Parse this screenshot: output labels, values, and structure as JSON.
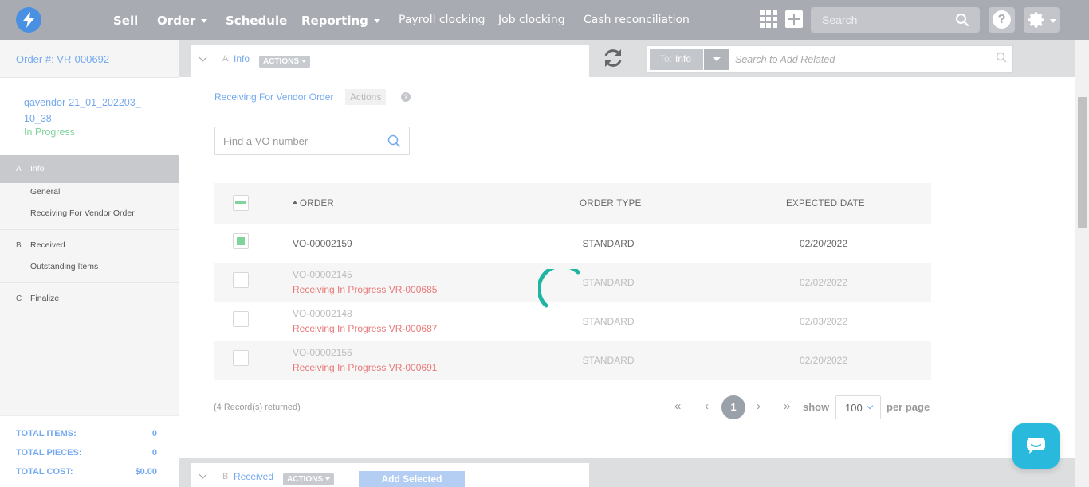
{
  "topnav": {
    "menu": [
      {
        "label": "Sell",
        "caret": false
      },
      {
        "label": "Order",
        "caret": true
      },
      {
        "label": "Schedule",
        "caret": false
      },
      {
        "label": "Reporting",
        "caret": true
      }
    ],
    "links": [
      "Payroll clocking",
      "Job clocking",
      "Cash reconciliation"
    ],
    "search_placeholder": "Search",
    "help_label": "?",
    "icons": {
      "logo": "lightning-bolt-icon",
      "apps": "apps-grid-icon",
      "add": "plus-icon",
      "search": "search-icon",
      "settings": "gear-icon"
    }
  },
  "sidebar": {
    "order_title": "Order #: VR-000692",
    "vendor_name": "qavendor-21_01_202203_10_38",
    "vendor_status": "In Progress",
    "sections": [
      {
        "letter": "A",
        "label": "Info",
        "active": true,
        "items": [
          "General",
          "Receiving For Vendor Order"
        ]
      },
      {
        "letter": "B",
        "label": "Received",
        "active": false,
        "items": [
          "Outstanding Items"
        ]
      },
      {
        "letter": "C",
        "label": "Finalize",
        "active": false,
        "items": []
      }
    ],
    "totals": [
      {
        "label": "TOTAL ITEMS:",
        "value": "0"
      },
      {
        "label": "TOTAL PIECES:",
        "value": "0"
      },
      {
        "label": "TOTAL COST:",
        "value": "$0.00"
      }
    ]
  },
  "info_section": {
    "letter": "A",
    "name": "Info",
    "actions_label": "ACTIONS",
    "to_label": "To:",
    "to_value": "Info",
    "related_placeholder": "Search to Add Related"
  },
  "receiving": {
    "label": "Receiving For Vendor Order",
    "actions_label": "Actions",
    "help": "?",
    "vo_placeholder": "Find a VO number"
  },
  "table": {
    "columns": [
      "ORDER",
      "ORDER TYPE",
      "EXPECTED DATE"
    ],
    "rows": [
      {
        "order": "VO-00002159",
        "status": "",
        "type": "STANDARD",
        "date": "02/20/2022",
        "checked": true,
        "muted": false
      },
      {
        "order": "VO-00002145",
        "status": "Receiving In Progress VR-000685",
        "type": "STANDARD",
        "date": "02/02/2022",
        "checked": false,
        "muted": true
      },
      {
        "order": "VO-00002148",
        "status": "Receiving In Progress VR-000687",
        "type": "STANDARD",
        "date": "02/03/2022",
        "checked": false,
        "muted": true
      },
      {
        "order": "VO-00002156",
        "status": "Receiving In Progress VR-000691",
        "type": "STANDARD",
        "date": "02/20/2022",
        "checked": false,
        "muted": true
      }
    ],
    "records_returned": "(4 Record(s) returned)"
  },
  "pagination": {
    "first": "«",
    "prev": "‹",
    "current_page": "1",
    "next": "›",
    "last": "»",
    "show_label": "show",
    "per_page_value": "100",
    "per_page_label": "per page"
  },
  "received_section": {
    "letter": "B",
    "name": "Received",
    "actions_label": "ACTIONS",
    "add_selected_label": "Add Selected"
  },
  "colors": {
    "accent_blue": "#74a9f0",
    "status_green": "#7fd49d",
    "warning_red": "#e87878",
    "spinner_teal": "#1fb5a3",
    "chat_blue": "#29b9dc",
    "nav_gray": "#a8abb2"
  }
}
